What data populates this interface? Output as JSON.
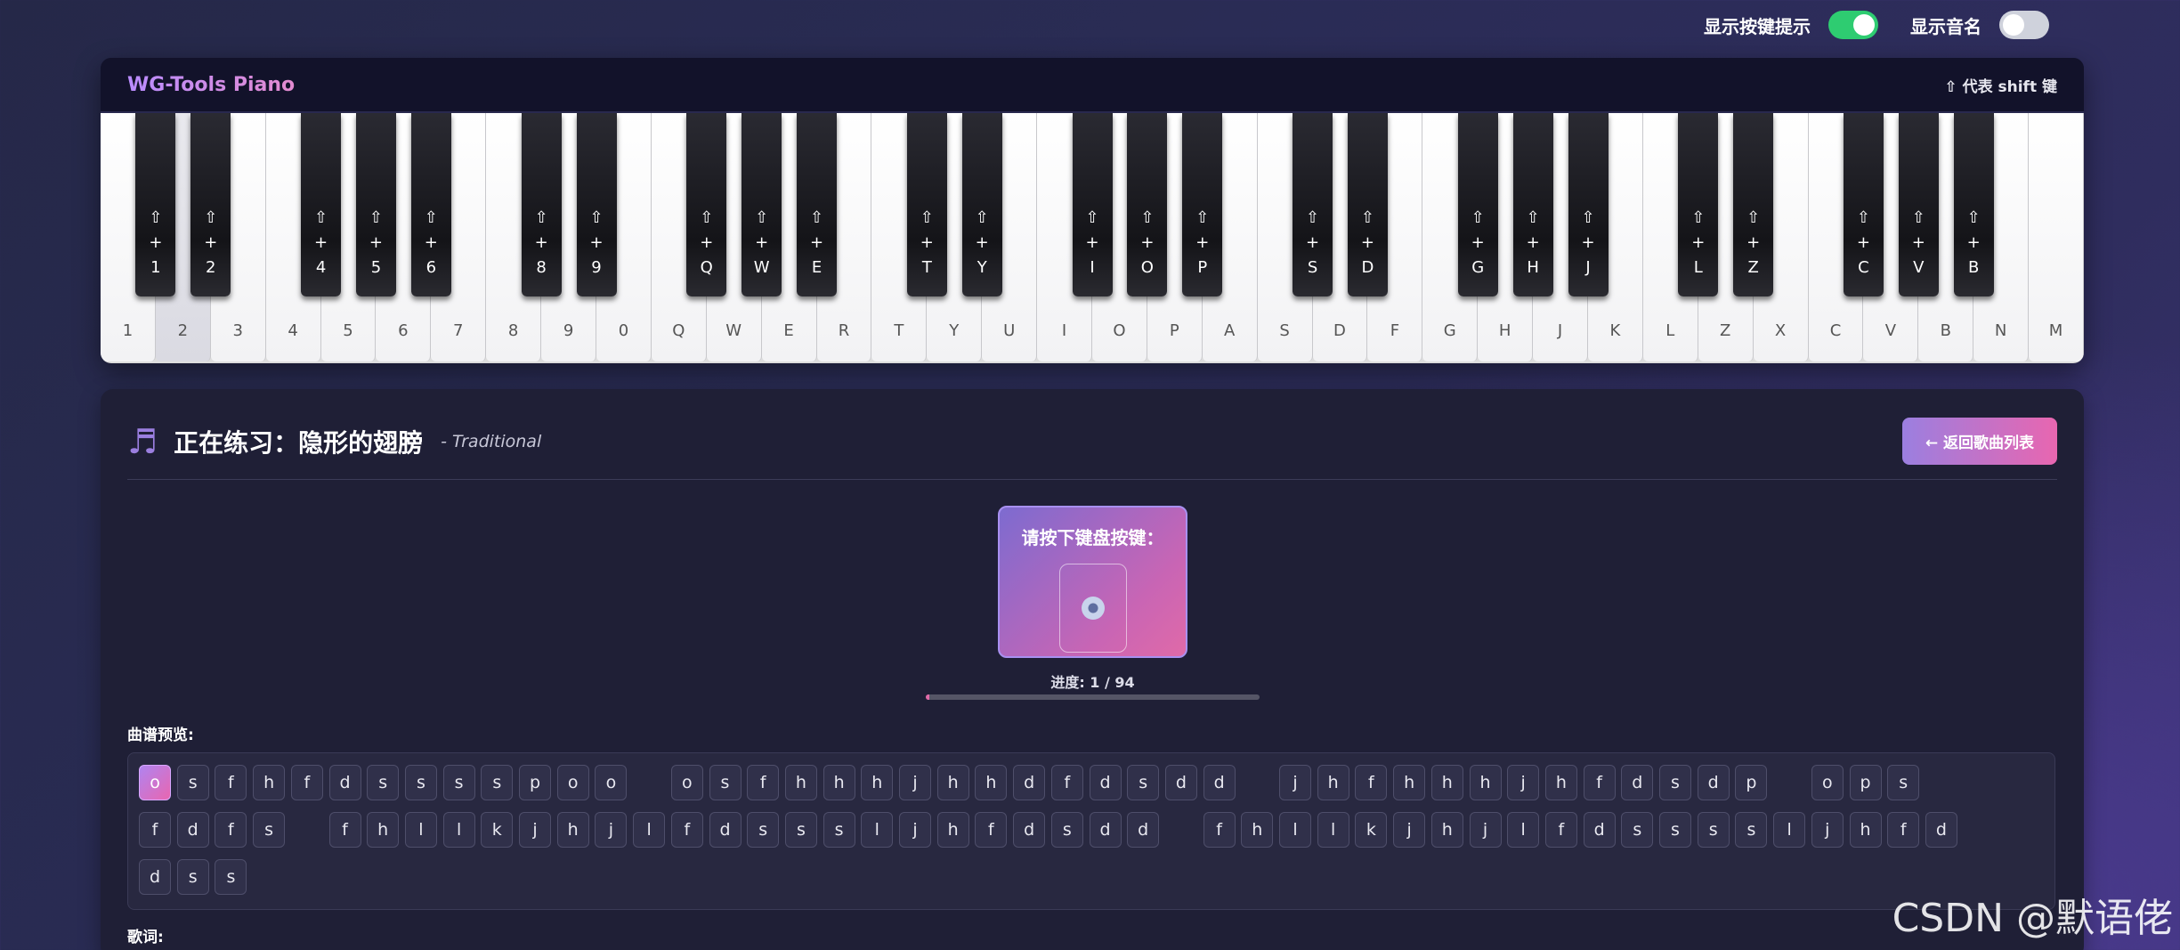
{
  "top_controls": {
    "show_key_hint_label": "显示按键提示",
    "show_key_hint_on": true,
    "show_note_name_label": "显示音名",
    "show_note_name_on": false
  },
  "piano": {
    "title": "WG-Tools Piano",
    "shift_hint": "⇧ 代表 shift 键",
    "white_keys": [
      "1",
      "2",
      "3",
      "4",
      "5",
      "6",
      "7",
      "8",
      "9",
      "0",
      "Q",
      "W",
      "E",
      "R",
      "T",
      "Y",
      "U",
      "I",
      "O",
      "P",
      "A",
      "S",
      "D",
      "F",
      "G",
      "H",
      "J",
      "K",
      "L",
      "Z",
      "X",
      "C",
      "V",
      "B",
      "N",
      "M"
    ],
    "black_keys": [
      {
        "shift": "⇧",
        "plus": "+",
        "key": "1"
      },
      {
        "shift": "⇧",
        "plus": "+",
        "key": "2"
      },
      {
        "shift": "⇧",
        "plus": "+",
        "key": "4"
      },
      {
        "shift": "⇧",
        "plus": "+",
        "key": "5"
      },
      {
        "shift": "⇧",
        "plus": "+",
        "key": "6"
      },
      {
        "shift": "⇧",
        "plus": "+",
        "key": "8"
      },
      {
        "shift": "⇧",
        "plus": "+",
        "key": "9"
      },
      {
        "shift": "⇧",
        "plus": "+",
        "key": "Q"
      },
      {
        "shift": "⇧",
        "plus": "+",
        "key": "W"
      },
      {
        "shift": "⇧",
        "plus": "+",
        "key": "E"
      },
      {
        "shift": "⇧",
        "plus": "+",
        "key": "T"
      },
      {
        "shift": "⇧",
        "plus": "+",
        "key": "Y"
      },
      {
        "shift": "⇧",
        "plus": "+",
        "key": "I"
      },
      {
        "shift": "⇧",
        "plus": "+",
        "key": "O"
      },
      {
        "shift": "⇧",
        "plus": "+",
        "key": "P"
      },
      {
        "shift": "⇧",
        "plus": "+",
        "key": "S"
      },
      {
        "shift": "⇧",
        "plus": "+",
        "key": "D"
      },
      {
        "shift": "⇧",
        "plus": "+",
        "key": "G"
      },
      {
        "shift": "⇧",
        "plus": "+",
        "key": "H"
      },
      {
        "shift": "⇧",
        "plus": "+",
        "key": "J"
      },
      {
        "shift": "⇧",
        "plus": "+",
        "key": "L"
      },
      {
        "shift": "⇧",
        "plus": "+",
        "key": "Z"
      },
      {
        "shift": "⇧",
        "plus": "+",
        "key": "C"
      },
      {
        "shift": "⇧",
        "plus": "+",
        "key": "V"
      },
      {
        "shift": "⇧",
        "plus": "+",
        "key": "B"
      }
    ],
    "pressed_white_key": "2"
  },
  "practice": {
    "music_icon": "♬",
    "title": "正在练习：隐形的翅膀",
    "artist": "- Traditional",
    "back_button": "← 返回歌曲列表",
    "prompt": "请按下键盘按键：",
    "progress_text": "进度: 1 / 94",
    "progress_fraction": 0.0106,
    "preview_label": "曲谱预览:",
    "lyrics_label": "歌词:",
    "notes_rows": [
      [
        "o",
        "s",
        "f",
        "h",
        "f",
        "d",
        "s",
        "s",
        "s",
        "s",
        "p",
        "o",
        "o",
        "",
        "o",
        "s",
        "f",
        "h",
        "h",
        "h",
        "j",
        "h",
        "h",
        "d",
        "f",
        "d",
        "s",
        "d",
        "d",
        "",
        "j",
        "h",
        "f",
        "h",
        "h",
        "h",
        "j",
        "h",
        "f",
        "d",
        "s",
        "d",
        "p",
        "",
        "o",
        "p",
        "s"
      ],
      [
        "f",
        "d",
        "f",
        "s",
        "",
        "f",
        "h",
        "l",
        "l",
        "k",
        "j",
        "h",
        "j",
        "l",
        "f",
        "d",
        "s",
        "s",
        "s",
        "l",
        "j",
        "h",
        "f",
        "d",
        "s",
        "d",
        "d",
        "",
        "f",
        "h",
        "l",
        "l",
        "k",
        "j",
        "h",
        "j",
        "l",
        "f",
        "d",
        "s",
        "s",
        "s",
        "s",
        "l",
        "j",
        "h",
        "f",
        "d"
      ],
      [
        "d",
        "s",
        "s"
      ]
    ]
  },
  "watermark": "CSDN @默语佬"
}
